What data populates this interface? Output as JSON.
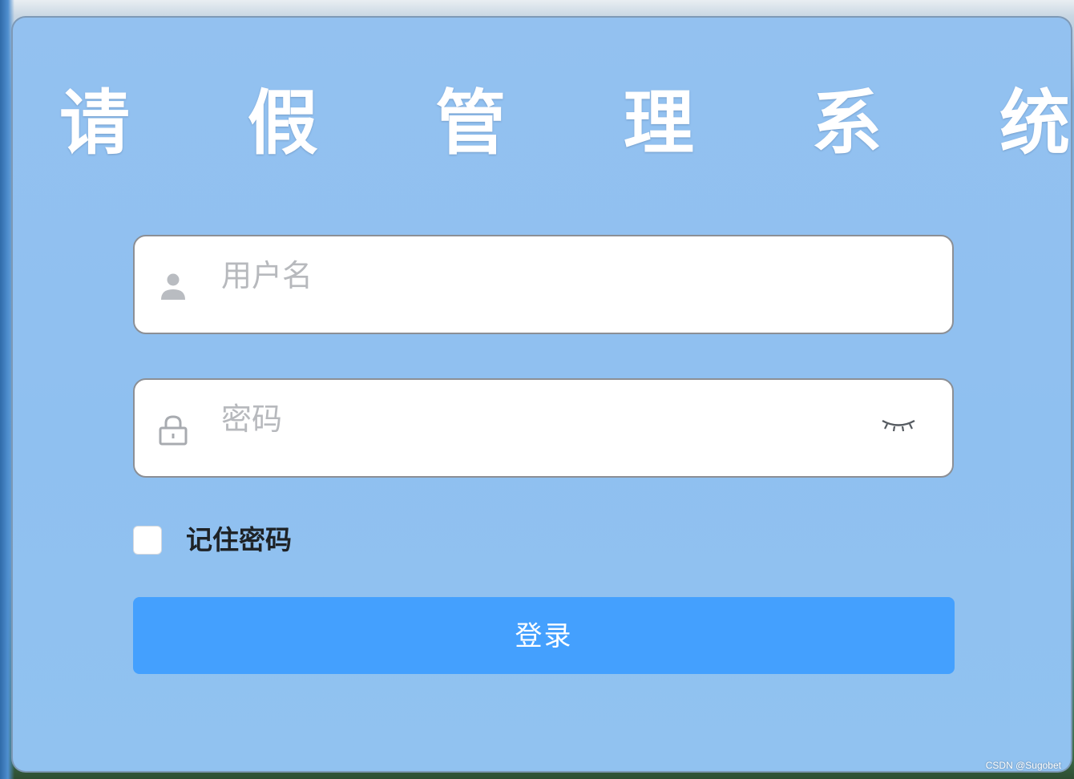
{
  "title": "请 假 管 理 系 统",
  "username": {
    "placeholder": "用户名",
    "value": "",
    "icon": "user-icon"
  },
  "password": {
    "placeholder": "密码",
    "value": "",
    "icon": "lock-icon",
    "toggle_icon": "eye-closed-icon"
  },
  "remember": {
    "label": "记住密码",
    "checked": false
  },
  "login_button": {
    "label": "登录"
  },
  "watermark": "CSDN @Sugobet",
  "colors": {
    "card": "#90c1f0",
    "button": "#44a0fe",
    "title": "#ffffff",
    "placeholder": "#b7b9bd"
  }
}
